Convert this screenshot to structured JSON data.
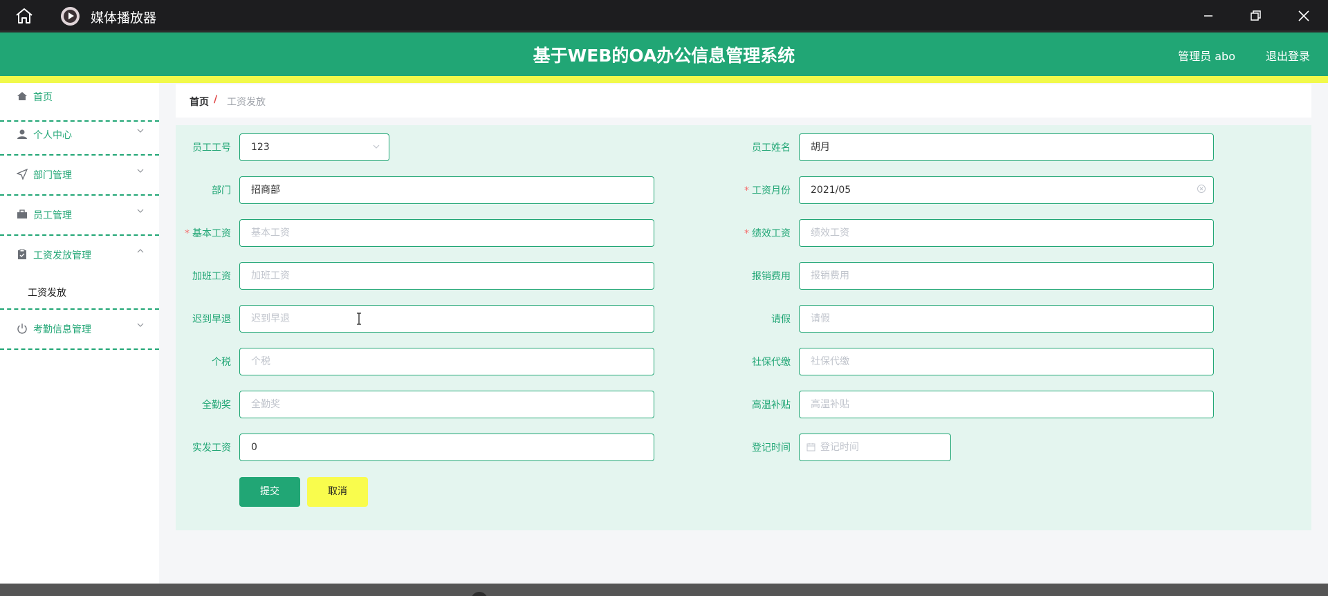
{
  "window": {
    "app_title": "媒体播放器"
  },
  "header": {
    "title": "基于WEB的OA办公信息管理系统",
    "user": "管理员 abo",
    "logout": "退出登录"
  },
  "sidebar": {
    "items": [
      {
        "label": "首页",
        "icon": "home-icon"
      },
      {
        "label": "个人中心",
        "icon": "user-icon"
      },
      {
        "label": "部门管理",
        "icon": "send-icon"
      },
      {
        "label": "员工管理",
        "icon": "briefcase-icon"
      },
      {
        "label": "工资发放管理",
        "icon": "clipboard-icon",
        "expanded": true
      },
      {
        "label": "考勤信息管理",
        "icon": "power-icon"
      }
    ],
    "submenu": "工资发放"
  },
  "breadcrumb": {
    "home": "首页",
    "separator": "/",
    "current": "工资发放"
  },
  "form": {
    "employee_id": {
      "label": "员工工号",
      "value": "123"
    },
    "employee_name": {
      "label": "员工姓名",
      "value": "胡月"
    },
    "department": {
      "label": "部门",
      "value": "招商部"
    },
    "salary_month": {
      "label": "工资月份",
      "value": "2021/05"
    },
    "base_salary": {
      "label": "基本工资",
      "placeholder": "基本工资"
    },
    "performance_salary": {
      "label": "绩效工资",
      "placeholder": "绩效工资"
    },
    "overtime_pay": {
      "label": "加班工资",
      "placeholder": "加班工资"
    },
    "reimbursement": {
      "label": "报销费用",
      "placeholder": "报销费用"
    },
    "late_early": {
      "label": "迟到早退",
      "placeholder": "迟到早退"
    },
    "leave": {
      "label": "请假",
      "placeholder": "请假"
    },
    "income_tax": {
      "label": "个税",
      "placeholder": "个税"
    },
    "social_security": {
      "label": "社保代缴",
      "placeholder": "社保代缴"
    },
    "attendance_bonus": {
      "label": "全勤奖",
      "placeholder": "全勤奖"
    },
    "heat_subsidy": {
      "label": "高温补贴",
      "placeholder": "高温补贴"
    },
    "actual_salary": {
      "label": "实发工资",
      "value": "0"
    },
    "register_time": {
      "label": "登记时间",
      "placeholder": "登记时间"
    },
    "required_mark": "*",
    "submit": "提交",
    "cancel": "取消"
  },
  "colors": {
    "primary": "#21a675",
    "accent_yellow": "#f1f94a",
    "form_bg": "#e4f5ef"
  }
}
